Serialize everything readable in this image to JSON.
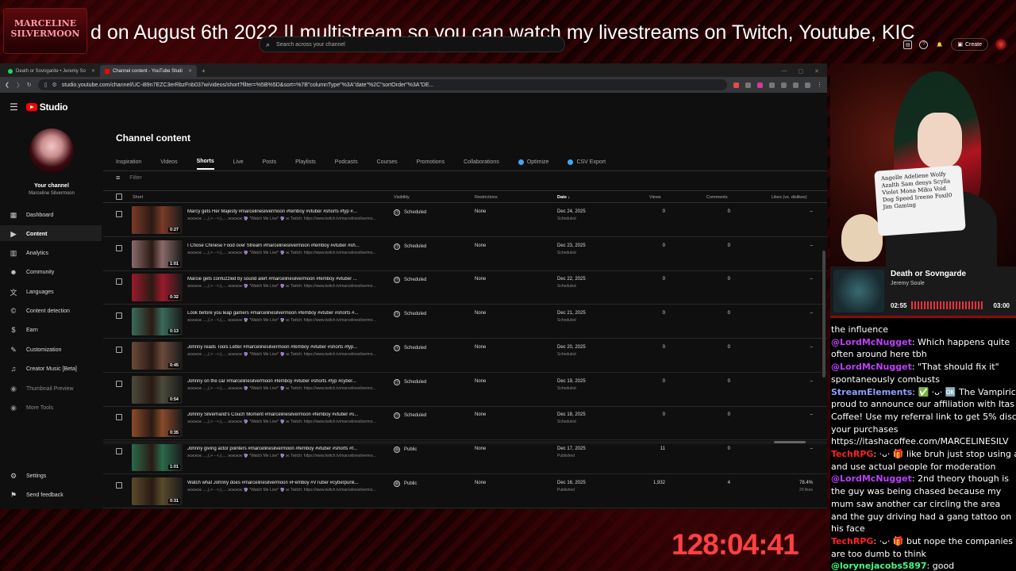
{
  "overlay": {
    "logo_text": "MARCELINE SILVERMOON",
    "marquee": "d on August 6th 2022.|I multistream so you can watch my livestreams on Twitch, Youtube, KIC",
    "timer": "128:04:41"
  },
  "browser": {
    "tabs": [
      {
        "label": "Death or Sovngarde • Jeremy So",
        "active": false
      },
      {
        "label": "Channel content - YouTube Studi",
        "active": true
      }
    ],
    "url": "studio.youtube.com/channel/UC-i89n7EZC3erRbzFnb037w/videos/short?filter=%5B%5D&sort=%7B\"columnType\"%3A\"date\"%2C\"sortOrder\"%3A\"DE..."
  },
  "header": {
    "logo": "Studio",
    "search_placeholder": "Search across your channel",
    "create_label": "Create"
  },
  "sidebar": {
    "your_channel": "Your channel",
    "channel_name": "Marceline Silvermoon",
    "items": [
      {
        "label": "Dashboard",
        "icon": "dashboard-icon"
      },
      {
        "label": "Content",
        "icon": "content-icon"
      },
      {
        "label": "Analytics",
        "icon": "analytics-icon"
      },
      {
        "label": "Community",
        "icon": "community-icon"
      },
      {
        "label": "Languages",
        "icon": "languages-icon"
      },
      {
        "label": "Content detection",
        "icon": "copyright-icon"
      },
      {
        "label": "Earn",
        "icon": "earn-icon"
      },
      {
        "label": "Customization",
        "icon": "customization-icon"
      },
      {
        "label": "Creator Music [Beta]",
        "icon": "music-icon"
      },
      {
        "label": "Thumbnail Preview",
        "icon": "thumbnail-icon"
      },
      {
        "label": "More Tools",
        "icon": "tools-icon"
      }
    ],
    "settings": "Settings",
    "feedback": "Send feedback"
  },
  "main": {
    "title": "Channel content",
    "tabs": [
      "Inspiration",
      "Videos",
      "Shorts",
      "Live",
      "Posts",
      "Playlists",
      "Podcasts",
      "Courses",
      "Promotions",
      "Collaborations",
      "Optimize",
      "CSV Export"
    ],
    "active_tab": "Shorts",
    "filter_placeholder": "Filter",
    "columns": {
      "short": "Short",
      "visibility": "Visibility",
      "restrictions": "Restrictions",
      "date": "Date ↓",
      "views": "Views",
      "comments": "Comments",
      "likes": "Likes (vs. dislikes)"
    },
    "rows": [
      {
        "title": "Marcy gets Her Majesty #marcelinesilvermoon #femboy #vtuber #shorts #fyp #...",
        "desc": "⫘⫘⫘⫘ ...⸜(˶˃ ᵕ ˂˶)⸝... ⫘⫘⫘⫘ 🔮 *Watch Me Live* 🔮 ⫘ Twitch: https://www.twitch.tv/marcelinesilvermoon - Kick:...",
        "duration": "0:27",
        "visibility": "Scheduled",
        "restrictions": "None",
        "date": "Dec 24, 2025",
        "date_sub": "Scheduled",
        "views": "0",
        "comments": "0",
        "likes": "–",
        "likes_sub": "",
        "thumb": "#7a3a28"
      },
      {
        "title": "I Chose Chinese Food over Stream #marcelinesilvermoon #femboy #vtuber #sh...",
        "desc": "⫘⫘⫘⫘ ...⸜(˶˃ ᵕ ˂˶)⸝... ⫘⫘⫘⫘ 🔮 *Watch Me Live* 🔮 ⫘ Twitch: https://www.twitch.tv/marcelinesilvermoon - Kick:...",
        "duration": "1:01",
        "visibility": "Scheduled",
        "restrictions": "None",
        "date": "Dec 23, 2025",
        "date_sub": "Scheduled",
        "views": "0",
        "comments": "0",
        "likes": "–",
        "likes_sub": "",
        "thumb": "#8a6a6a"
      },
      {
        "title": "Marcie gets confuzzled by sound alert #marcelinesilvermoon #femboy #vtuber ...",
        "desc": "⫘⫘⫘⫘ ...⸜(˶˃ ᵕ ˂˶)⸝... ⫘⫘⫘⫘ 🔮 *Watch Me Live* 🔮 ⫘ Twitch: https://www.twitch.tv/marcelinesilvermoon - Kick:...",
        "duration": "0:32",
        "visibility": "Scheduled",
        "restrictions": "None",
        "date": "Dec 22, 2025",
        "date_sub": "Scheduled",
        "views": "0",
        "comments": "0",
        "likes": "–",
        "likes_sub": "",
        "thumb": "#9a1a2a"
      },
      {
        "title": "Look before you leap gamers #marcelinesilvermoon #femboy #vtuber #shorts #...",
        "desc": "⫘⫘⫘⫘ ...⸜(˶˃ ᵕ ˂˶)⸝... ⫘⫘⫘⫘ 🔮 *Watch Me Live* 🔮 ⫘ Twitch: https://www.twitch.tv/marcelinesilvermoon - Kick:...",
        "duration": "0:13",
        "visibility": "Scheduled",
        "restrictions": "None",
        "date": "Dec 21, 2025",
        "date_sub": "Scheduled",
        "views": "0",
        "comments": "0",
        "likes": "–",
        "likes_sub": "",
        "thumb": "#3a6a5a"
      },
      {
        "title": "Johnny reads Tools Letter #marcelinesilvermoon #femboy #vtuber #shorts #fyp...",
        "desc": "⫘⫘⫘⫘ ...⸜(˶˃ ᵕ ˂˶)⸝... ⫘⫘⫘⫘ 🔮 *Watch Me Live* 🔮 ⫘ Twitch: https://www.twitch.tv/marcelinesilvermoon - Kick:...",
        "duration": "0:45",
        "visibility": "Scheduled",
        "restrictions": "None",
        "date": "Dec 20, 2025",
        "date_sub": "Scheduled",
        "views": "0",
        "comments": "0",
        "likes": "–",
        "likes_sub": "",
        "thumb": "#6a4a3a"
      },
      {
        "title": "Johnny on the car #marcelinesilvermoon #femboy #vtuber #shorts #fyp #cyber...",
        "desc": "⫘⫘⫘⫘ ...⸜(˶˃ ᵕ ˂˶)⸝... ⫘⫘⫘⫘ 🔮 *Watch Me Live* 🔮 ⫘ Twitch: https://www.twitch.tv/marcelinesilvermoon - Kick:...",
        "duration": "0:54",
        "visibility": "Scheduled",
        "restrictions": "None",
        "date": "Dec 19, 2025",
        "date_sub": "Scheduled",
        "views": "0",
        "comments": "0",
        "likes": "–",
        "likes_sub": "",
        "thumb": "#4a4a3a"
      },
      {
        "title": "Johnny Silverhand's Couch Moment #marcelinesilvermoon #femboy #vtuber #s...",
        "desc": "⫘⫘⫘⫘ ...⸜(˶˃ ᵕ ˂˶)⸝... ⫘⫘⫘⫘ 🔮 *Watch Me Live* 🔮 ⫘ Twitch: https://www.twitch.tv/marcelinesilvermoon - Kick:...",
        "duration": "0:35",
        "visibility": "Scheduled",
        "restrictions": "None",
        "date": "Dec 18, 2025",
        "date_sub": "Scheduled",
        "views": "0",
        "comments": "0",
        "likes": "–",
        "likes_sub": "",
        "thumb": "#8a4a2a"
      },
      {
        "title": "Johnny giving actor pointers #marcelinesilvermoon #femboy #vtuber #shorts #f...",
        "desc": "⫘⫘⫘⫘ ...⸜(˶˃ ᵕ ˂˶)⸝... ⫘⫘⫘⫘ 🔮 *Watch Me Live* 🔮 ⫘ Twitch: https://www.twitch.tv/marcelinesilvermoon - Kick:...",
        "duration": "1:01",
        "visibility": "Public",
        "restrictions": "None",
        "date": "Dec 17, 2025",
        "date_sub": "Published",
        "views": "11",
        "comments": "0",
        "likes": "–",
        "likes_sub": "",
        "thumb": "#2a6a4a"
      },
      {
        "title": "Watch what Johnny does #marcelinesilvermoon #Femboy #VTuber #cyberpunk...",
        "desc": "⫘⫘⫘⫘ ...⸜(˶˃ ᵕ ˂˶)⸝... ⫘⫘⫘⫘ 🔮 *Watch Me Live* 🔮 ⫘ Twitch: https://www.twitch.tv/marcelinesilvermoon - Kick:...",
        "duration": "0:31",
        "visibility": "Public",
        "restrictions": "None",
        "date": "Dec 16, 2025",
        "date_sub": "Published",
        "views": "1,932",
        "comments": "4",
        "likes": "78.4%",
        "likes_sub": "29 likes",
        "thumb": "#5a4a2a"
      }
    ]
  },
  "character": {
    "sign_names": [
      "Angelle",
      "Adeliene",
      "Wolfy",
      "Azalth",
      "Sam",
      "denys",
      "Scylla",
      "Violet",
      "Mona",
      "Miku",
      "Void",
      "Dog",
      "Speed",
      "Ireeno",
      "Foxil0",
      "Jim",
      "Gaming"
    ]
  },
  "now_playing": {
    "title": "Death or Sovngarde",
    "artist": "Jeremy Soule",
    "elapsed": "02:55",
    "total": "03:00"
  },
  "chat": [
    {
      "user": "",
      "text": "the influence",
      "color": "#ffffff"
    },
    {
      "user": "@LordMcNugget",
      "text": ": Which happens quite",
      "color": "#c040ff"
    },
    {
      "user": "",
      "text": "often around here tbh",
      "color": "#ffffff"
    },
    {
      "user": "@LordMcNugget",
      "text": ": \"That should fix it\"",
      "color": "#c040ff"
    },
    {
      "user": "",
      "text": "spontaneously combusts",
      "color": "#ffffff"
    },
    {
      "user": "StreamElements",
      "text": ": ✅ ·ᴗ· 🆗 The Vampiric Cov",
      "color": "#8aa0ff"
    },
    {
      "user": "",
      "text": "proud to announce our affiliation with Itas",
      "color": "#ffffff"
    },
    {
      "user": "",
      "text": "Coffee! Use my referral link to get 5% disc",
      "color": "#ffffff"
    },
    {
      "user": "",
      "text": "your purchases",
      "color": "#ffffff"
    },
    {
      "user": "",
      "text": "https://itashacoffee.com/MARCELINESILV",
      "color": "#ffffff"
    },
    {
      "user": "TechRPG",
      "text": ": ·ᴗ· 🎁 like bruh just stop using ai",
      "color": "#ff2020"
    },
    {
      "user": "",
      "text": "and use actual people for moderation",
      "color": "#ffffff"
    },
    {
      "user": "@LordMcNugget",
      "text": ": 2nd theory though is",
      "color": "#c040ff"
    },
    {
      "user": "",
      "text": "the guy was being chased because my",
      "color": "#ffffff"
    },
    {
      "user": "",
      "text": "mum saw another car circling the area",
      "color": "#ffffff"
    },
    {
      "user": "",
      "text": "and the guy driving had a gang tattoo on",
      "color": "#ffffff"
    },
    {
      "user": "",
      "text": "his face",
      "color": "#ffffff"
    },
    {
      "user": "TechRPG",
      "text": ": ·ᴗ· 🎁 but nope the companies",
      "color": "#ff2020"
    },
    {
      "user": "",
      "text": "are too dumb to think",
      "color": "#ffffff"
    },
    {
      "user": "@lorynejacobs5897",
      "text": ": good",
      "color": "#40ff80"
    }
  ]
}
